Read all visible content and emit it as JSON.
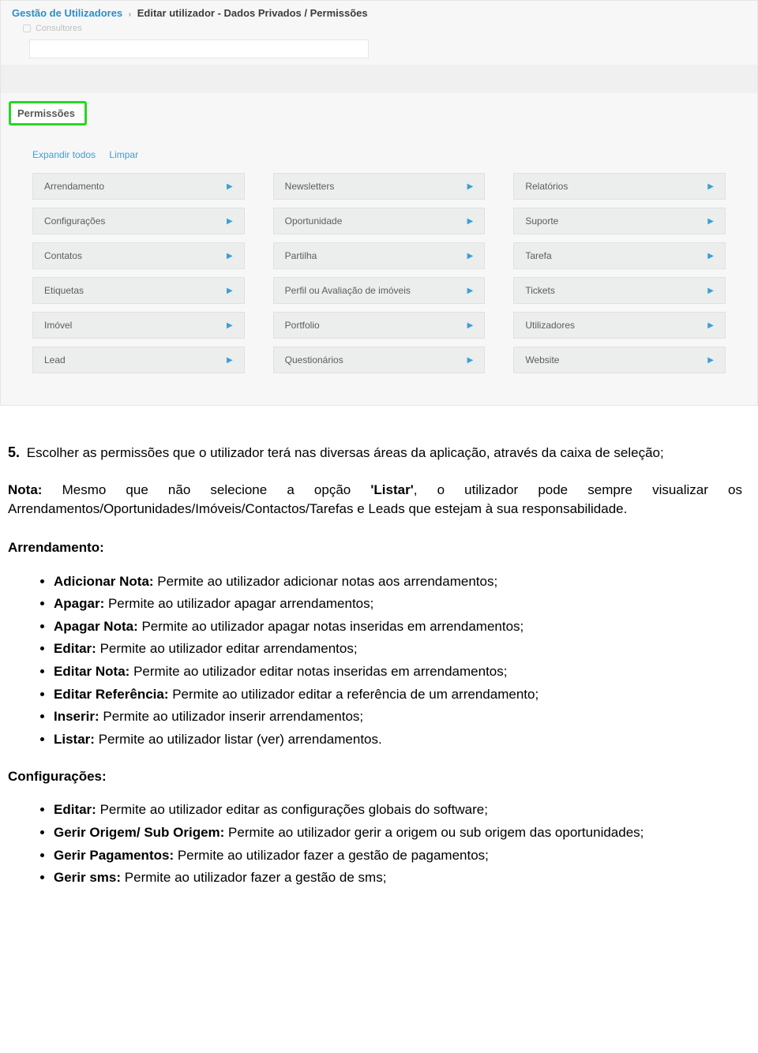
{
  "breadcrumb": {
    "link": "Gestão de Utilizadores",
    "separator": "›",
    "current": "Editar utilizador -  Dados Privados / Permissões"
  },
  "subline": {
    "text": "Consultores"
  },
  "tab": {
    "label": "Permissões"
  },
  "actions": {
    "expand": "Expandir todos",
    "clear": "Limpar"
  },
  "permissions": {
    "col1": [
      {
        "label": "Arrendamento"
      },
      {
        "label": "Configurações"
      },
      {
        "label": "Contatos"
      },
      {
        "label": "Etiquetas"
      },
      {
        "label": "Imóvel"
      },
      {
        "label": "Lead"
      }
    ],
    "col2": [
      {
        "label": "Newsletters"
      },
      {
        "label": "Oportunidade"
      },
      {
        "label": "Partilha"
      },
      {
        "label": "Perfil ou Avaliação de imóveis"
      },
      {
        "label": "Portfolio"
      },
      {
        "label": "Questionários"
      }
    ],
    "col3": [
      {
        "label": "Relatórios"
      },
      {
        "label": "Suporte"
      },
      {
        "label": "Tarefa"
      },
      {
        "label": "Tickets"
      },
      {
        "label": "Utilizadores"
      },
      {
        "label": "Website"
      }
    ]
  },
  "doc": {
    "step_num": "5.",
    "step_text": " Escolher as permissões que o utilizador terá nas diversas áreas da aplicação, através da caixa de seleção;",
    "note_label": "Nota:",
    "note_before": " Mesmo que não selecione a opção ",
    "note_quoted": "'Listar'",
    "note_after": ", o utilizador pode sempre visualizar os Arrendamentos/Oportunidades/Imóveis/Contactos/Tarefas e Leads que estejam à sua responsabilidade.",
    "section1_title": "Arrendamento:",
    "section1_items": [
      {
        "bold": "Adicionar Nota:",
        "text": " Permite ao utilizador adicionar notas aos arrendamentos;"
      },
      {
        "bold": "Apagar:",
        "text": " Permite ao utilizador apagar arrendamentos;"
      },
      {
        "bold": "Apagar Nota:",
        "text": " Permite ao utilizador apagar notas inseridas em arrendamentos;"
      },
      {
        "bold": "Editar:",
        "text": " Permite ao utilizador editar arrendamentos;"
      },
      {
        "bold": "Editar Nota:",
        "text": " Permite ao utilizador editar notas inseridas em arrendamentos;"
      },
      {
        "bold": "Editar Referência:",
        "text": " Permite ao utilizador editar a referência de um arrendamento;"
      },
      {
        "bold": "Inserir:",
        "text": " Permite ao utilizador inserir arrendamentos;"
      },
      {
        "bold": "Listar:",
        "text": " Permite ao utilizador listar (ver) arrendamentos."
      }
    ],
    "section2_title": "Configurações:",
    "section2_items": [
      {
        "bold": "Editar:",
        "text": " Permite ao utilizador editar as configurações globais do software;"
      },
      {
        "bold": "Gerir Origem/ Sub Origem:",
        "text": " Permite ao utilizador gerir a origem ou sub origem das oportunidades;"
      },
      {
        "bold": "Gerir Pagamentos:",
        "text": " Permite ao utilizador fazer a gestão de pagamentos;"
      },
      {
        "bold": "Gerir sms:",
        "text": " Permite ao utilizador fazer a gestão de sms;"
      }
    ]
  }
}
